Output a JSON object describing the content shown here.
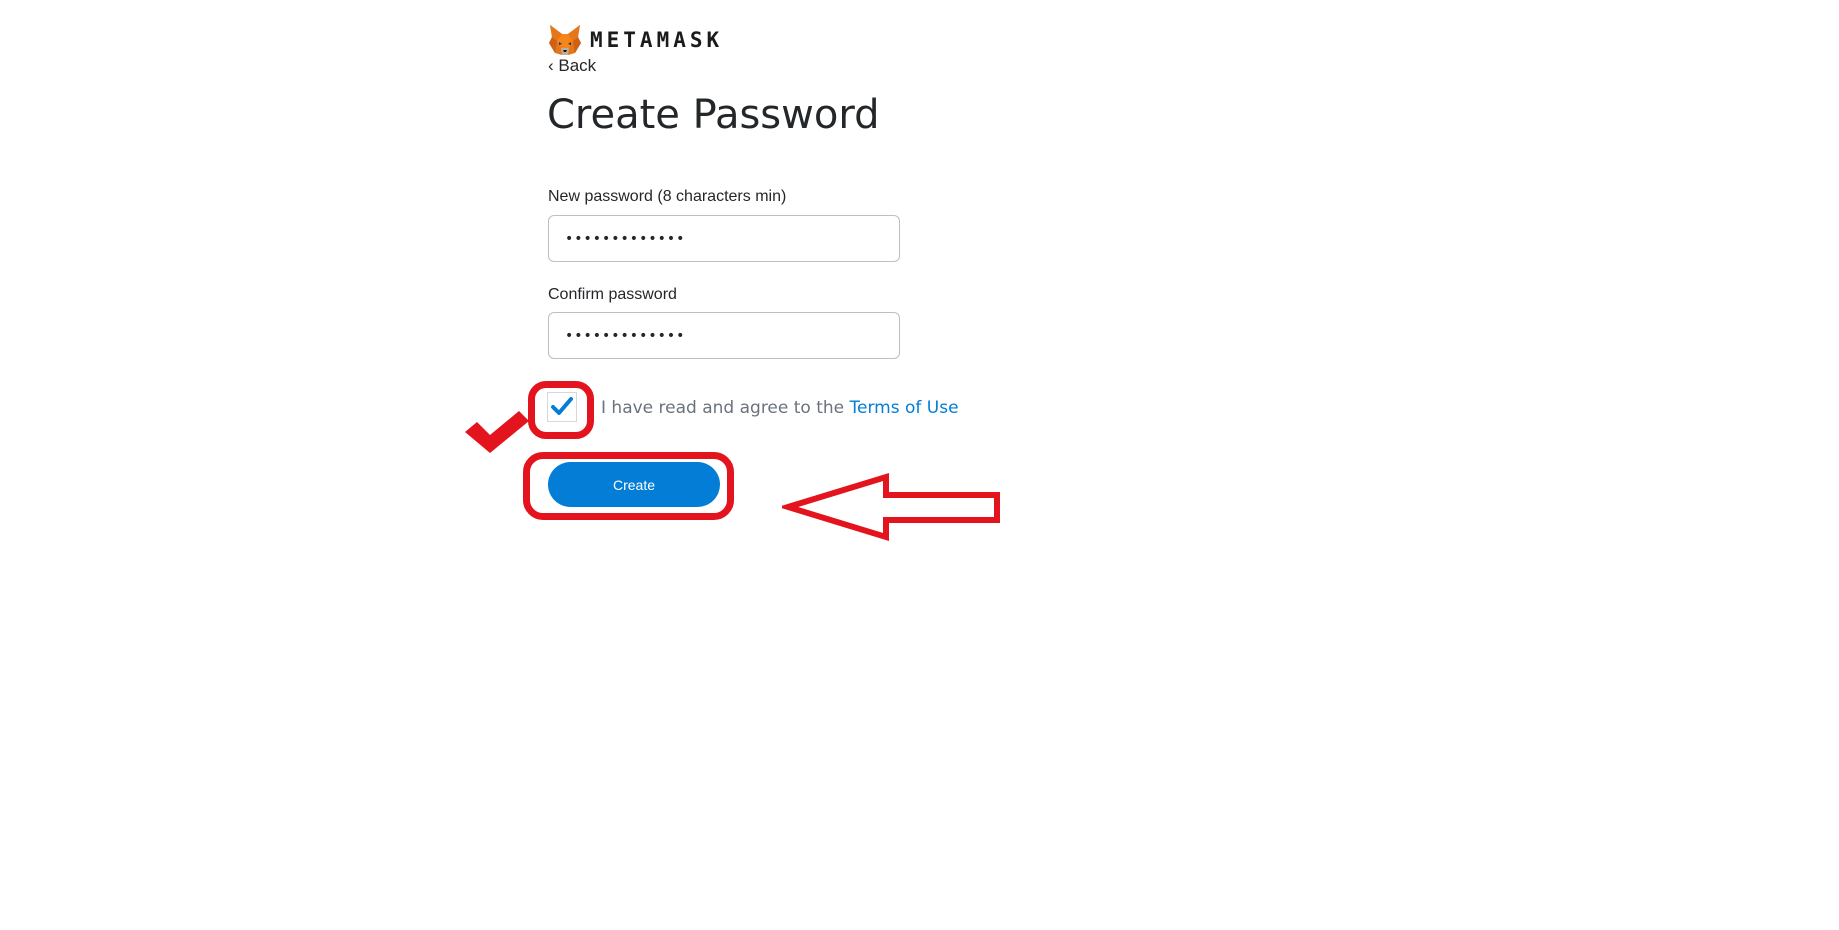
{
  "brand": {
    "wordmark": "METAMASK",
    "logo_icon": "fox-icon"
  },
  "nav": {
    "back_label": "‹ Back"
  },
  "form": {
    "title": "Create Password",
    "new_password": {
      "label": "New password (8 characters min)",
      "value": "•••••••••••••"
    },
    "confirm_password": {
      "label": "Confirm password",
      "value": "•••••••••••••"
    },
    "agree": {
      "checked": true,
      "text": "I have read and agree to the ",
      "link_text": "Terms of Use"
    },
    "create_label": "Create"
  },
  "colors": {
    "accent": "#037dd6",
    "annotation": "#e3141e",
    "text": "#24272a",
    "muted_text": "#6a737d"
  }
}
